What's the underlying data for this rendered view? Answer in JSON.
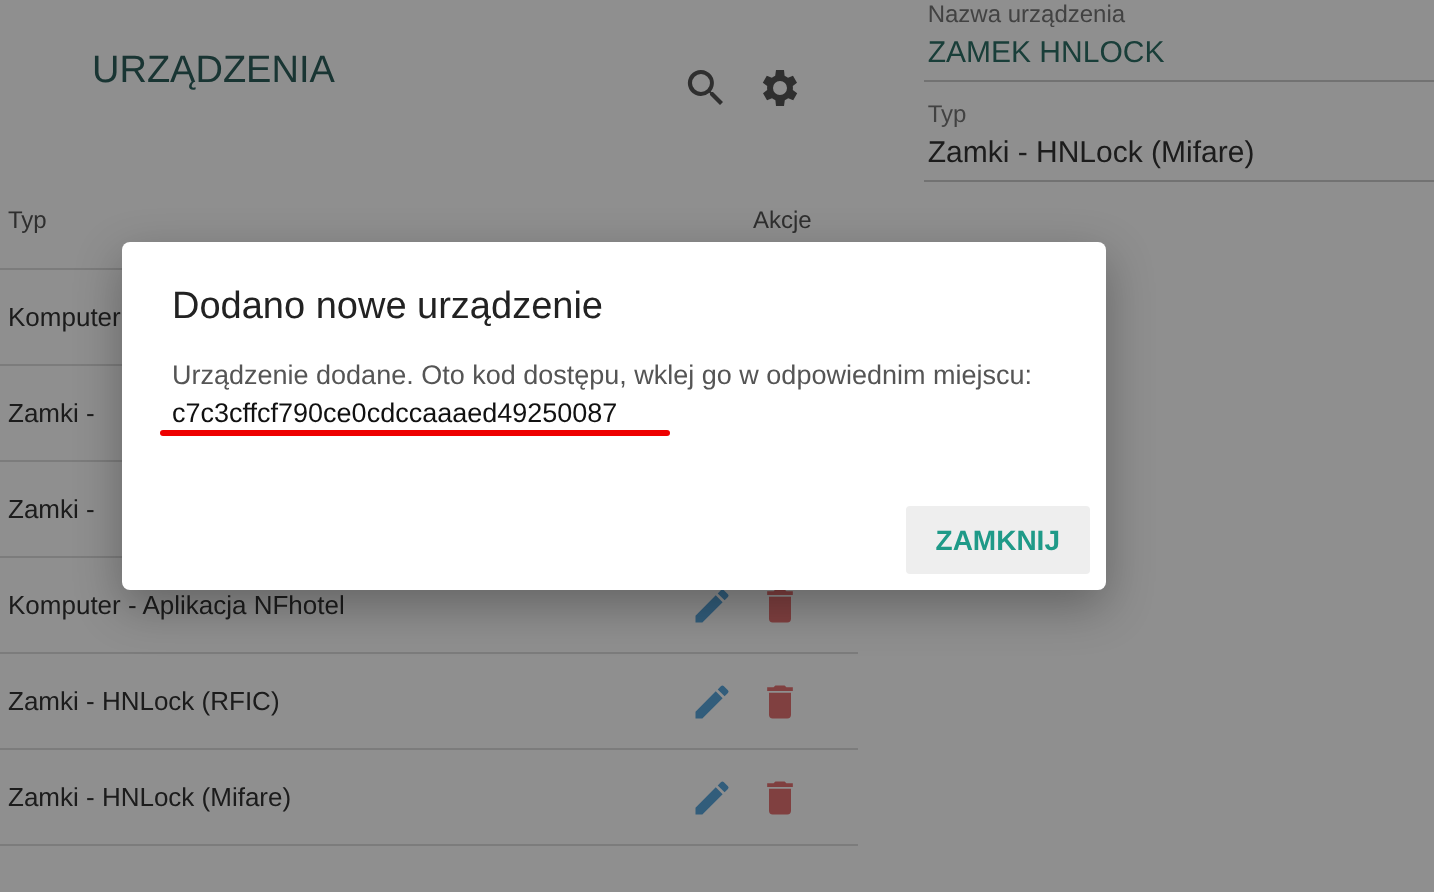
{
  "page": {
    "title": "URZĄDZENIA"
  },
  "table": {
    "columns": [
      "Typ",
      "Akcje"
    ],
    "rows": [
      {
        "type": "Komputer",
        "actions": false
      },
      {
        "type": "Zamki -",
        "actions": false
      },
      {
        "type": "Zamki -",
        "actions": false
      },
      {
        "type": "Komputer - Aplikacja NFhotel",
        "actions": true
      },
      {
        "type": "Zamki - HNLock (RFIC)",
        "actions": true
      },
      {
        "type": "Zamki - HNLock (Mifare)",
        "actions": true
      }
    ]
  },
  "form": {
    "fields": [
      {
        "label": "Nazwa urządzenia",
        "value": "ZAMEK HNLOCK",
        "kind": "name"
      },
      {
        "label": "Typ",
        "value": "Zamki - HNLock (Mifare)",
        "kind": "plain"
      }
    ]
  },
  "dialog": {
    "title": "Dodano nowe urządzenie",
    "message": "Urządzenie dodane. Oto kod dostępu, wklej go w odpowiednim miejscu:",
    "code": "c7c3cffcf790ce0cdccaaaed49250087",
    "button": "ZAMKNIJ"
  }
}
